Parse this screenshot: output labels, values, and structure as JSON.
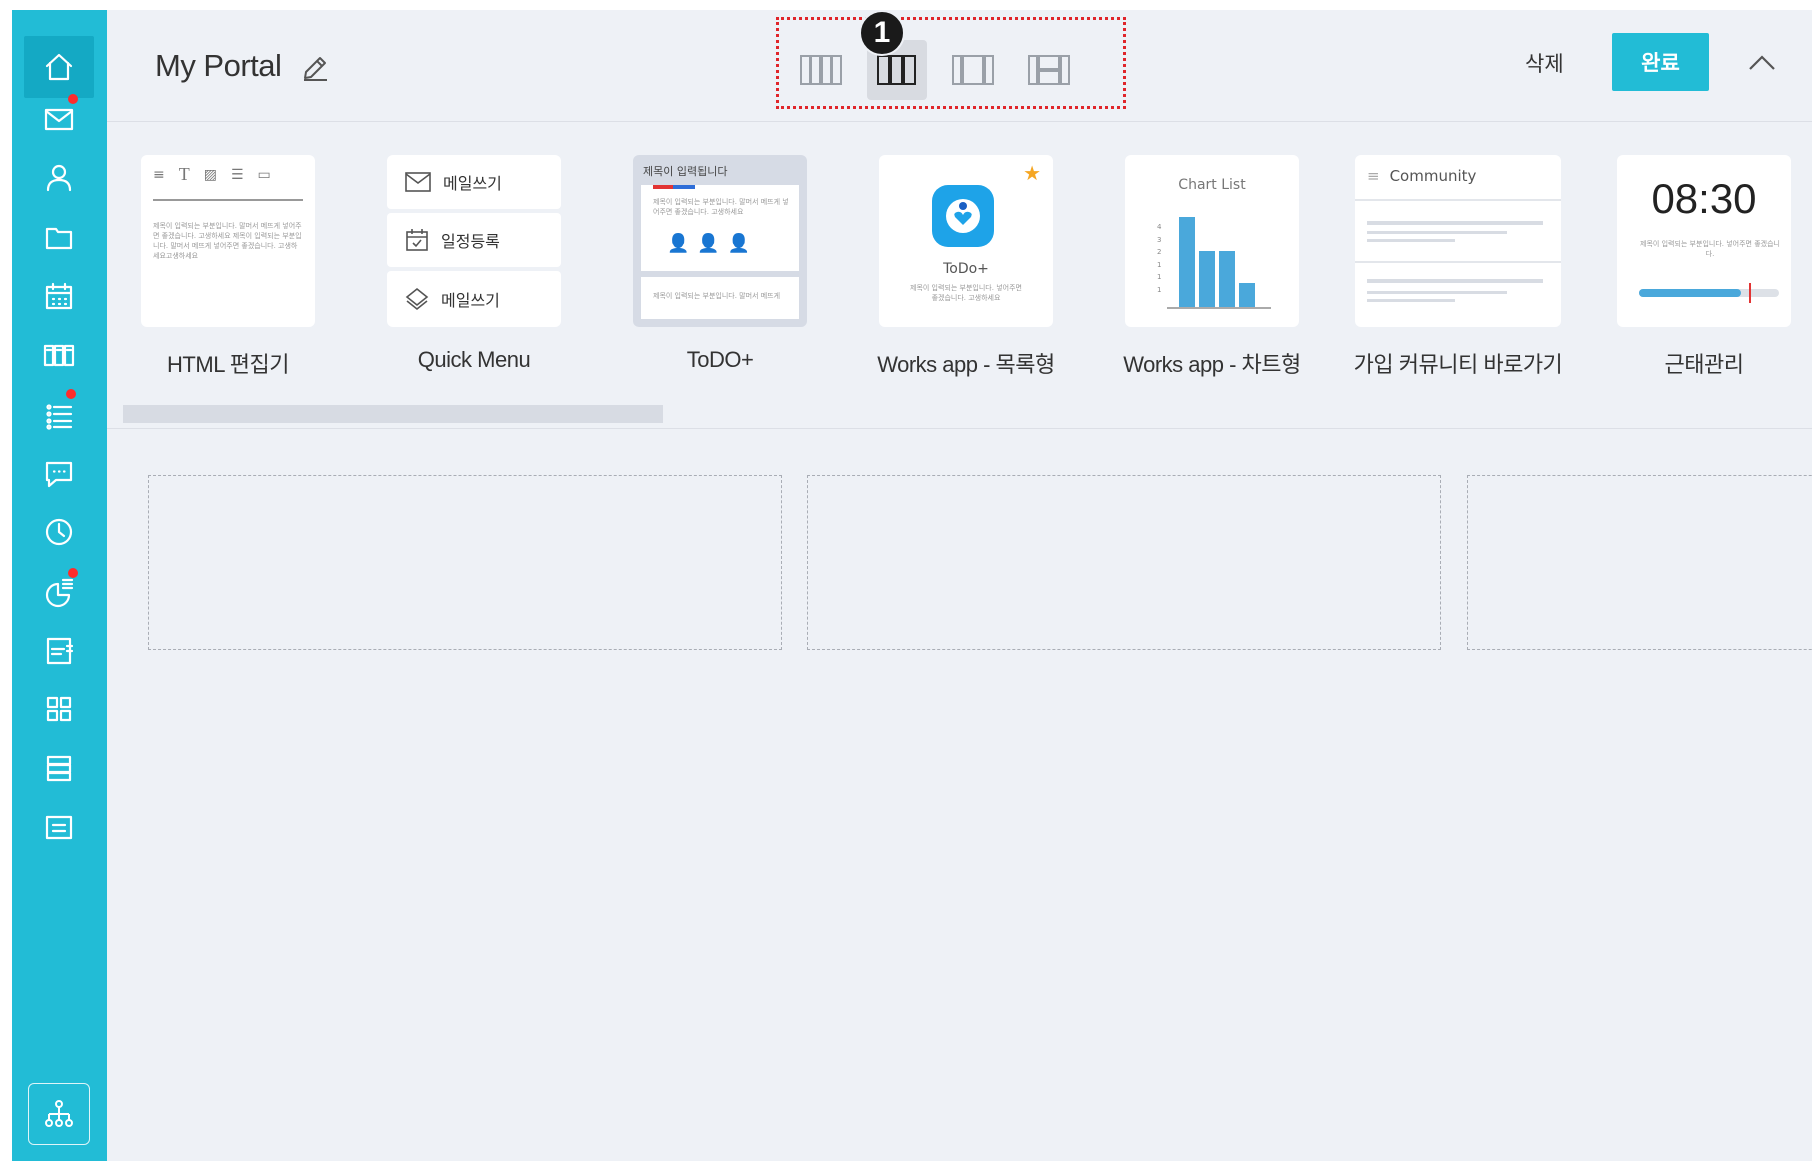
{
  "header": {
    "title": "My Portal",
    "layout_badge": "1",
    "delete_label": "삭제",
    "done_label": "완료"
  },
  "sidebar": {
    "items": [
      {
        "icon": "home-icon",
        "notification": false,
        "active": true
      },
      {
        "icon": "mail-icon",
        "notification": true
      },
      {
        "icon": "contacts-icon",
        "notification": false
      },
      {
        "icon": "folder-icon",
        "notification": false
      },
      {
        "icon": "calendar-icon",
        "notification": false
      },
      {
        "icon": "columns-icon",
        "notification": false
      },
      {
        "icon": "task-list-icon",
        "notification": true
      },
      {
        "icon": "chat-icon",
        "notification": false
      },
      {
        "icon": "clock-icon",
        "notification": false
      },
      {
        "icon": "report-icon",
        "notification": true
      },
      {
        "icon": "board-icon",
        "notification": false
      },
      {
        "icon": "apps-grid-icon",
        "notification": false
      },
      {
        "icon": "rows-icon",
        "notification": false
      },
      {
        "icon": "note-icon",
        "notification": false
      }
    ],
    "org_icon": "org-chart-icon"
  },
  "layouts": [
    {
      "name": "layout-4-columns",
      "selected": false
    },
    {
      "name": "layout-3-columns",
      "selected": true
    },
    {
      "name": "layout-wide-center",
      "selected": false
    },
    {
      "name": "layout-split-center",
      "selected": false
    }
  ],
  "widgets": [
    {
      "label": "HTML 편집기",
      "preview_text": "제목이 입력되는 부분입니다. 말머서 메뜨게 넣어주면 좋겠습니다. 고생하세요 제목이 입력되는 부분입니다. 말머서 메뜨게 넣어주면 좋겠습니다. 고생하세요고생하세요"
    },
    {
      "label": "Quick Menu",
      "items": [
        "메일쓰기",
        "일정등록",
        "메일쓰기"
      ]
    },
    {
      "label": "ToDO+",
      "preview_title": "제목이 입력됩니다",
      "preview_text": "제목이 입력되는 부분입니다. 말머서 메뜨게 넣어주면 좋겠습니다. 고생하세요",
      "preview_footer": "제목이 입력되는 부분입니다. 말머서 메뜨게"
    },
    {
      "label": "Works app - 목록형",
      "app_name": "ToDo+",
      "preview_text": "제목이 입력되는 부분입니다. 넣어주면 좋겠습니다. 고생하세요"
    },
    {
      "label": "Works app - 차트형",
      "chart_title": "Chart List",
      "y_ticks": [
        "4",
        "3",
        "2",
        "1",
        "1",
        "1"
      ]
    },
    {
      "label": "가입 커뮤니티 바로가기",
      "preview_title": "Community"
    },
    {
      "label": "근태관리",
      "time": "08:30",
      "preview_text": "제목이 입력되는 부분입니다. 넣어주면 좋겠습니다.",
      "progress": 0.73
    }
  ],
  "colors": {
    "accent": "#22bcd6",
    "notification": "#ff2b2b",
    "highlight_border": "#e0252a"
  }
}
